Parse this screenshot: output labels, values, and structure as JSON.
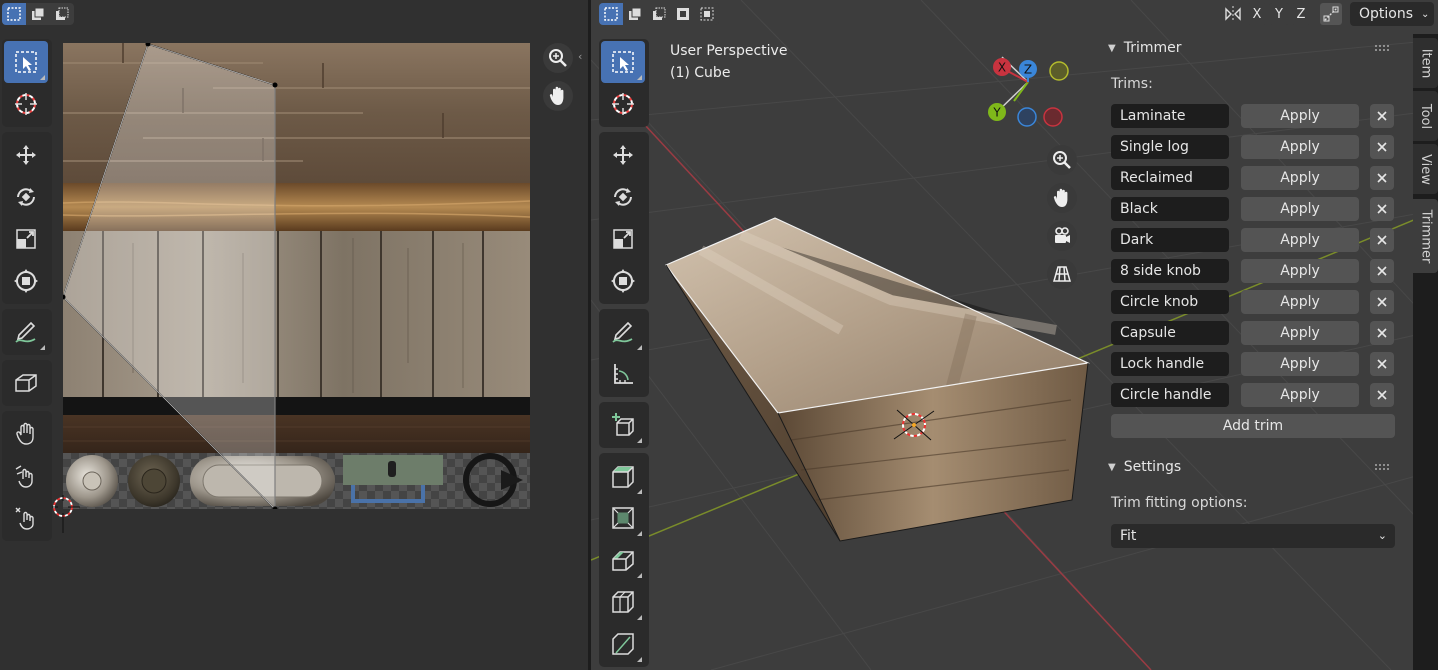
{
  "uv_editor": {
    "select_mode_icons": [
      "select-box-icon",
      "select-extend-icon",
      "select-subtract-icon"
    ],
    "tools": [
      "select-box-icon",
      "cursor-icon",
      "move-icon",
      "rotate-icon",
      "scale-icon",
      "transform-icon",
      "annotate-icon",
      "rip-region-icon",
      "grab-icon",
      "relax-icon",
      "pinch-icon"
    ],
    "nav": [
      "zoom-icon",
      "pan-hand-icon"
    ]
  },
  "viewport": {
    "perspective": "User Perspective",
    "object": "(1) Cube",
    "select_mode_icons": [
      "select-box-icon",
      "select-extend-icon",
      "select-subtract-icon",
      "select-invert-icon",
      "select-intersect-icon"
    ],
    "axis_buttons": [
      "X",
      "Y",
      "Z"
    ],
    "options_label": "Options",
    "gizmo": {
      "x": "X",
      "y": "Y",
      "z": "Z"
    },
    "tools": [
      "select-box-icon",
      "cursor-icon",
      "move-icon",
      "rotate-icon",
      "scale-icon",
      "transform-icon",
      "annotate-icon",
      "measure-icon",
      "add-cube-icon",
      "extrude-icon",
      "inset-icon",
      "bevel-icon",
      "loop-cut-icon",
      "knife-icon"
    ],
    "nav": [
      "zoom-icon",
      "pan-hand-icon",
      "camera-icon",
      "grid-icon"
    ]
  },
  "trimmer_panel": {
    "title": "Trimmer",
    "trims_label": "Trims:",
    "apply_label": "Apply",
    "trims": [
      "Laminate",
      "Single log",
      "Reclaimed",
      "Black",
      "Dark",
      "8 side knob",
      "Circle knob",
      "Capsule",
      "Lock handle",
      "Circle handle"
    ],
    "add_trim_label": "Add trim"
  },
  "settings_panel": {
    "title": "Settings",
    "fitting_label": "Trim fitting options:",
    "fitting_value": "Fit"
  },
  "sidebar_tabs": [
    "Item",
    "Tool",
    "View",
    "Trimmer"
  ],
  "colors": {
    "accent": "#4772b3",
    "axis_x": "#c8333f",
    "axis_y": "#7fb81a",
    "axis_z": "#3a86d9"
  }
}
